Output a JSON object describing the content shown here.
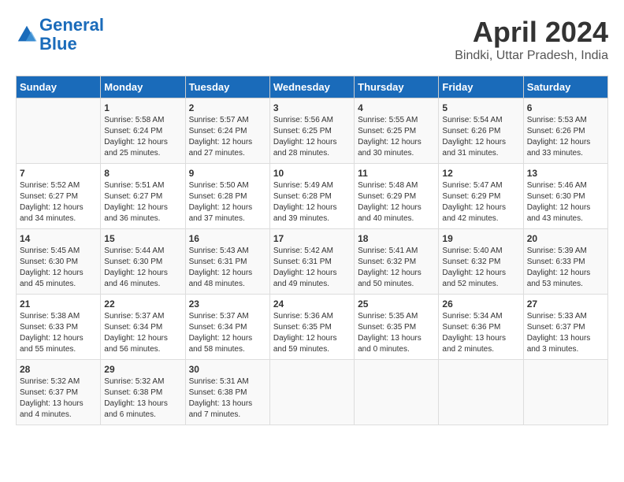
{
  "header": {
    "logo_line1": "General",
    "logo_line2": "Blue",
    "month_title": "April 2024",
    "location": "Bindki, Uttar Pradesh, India"
  },
  "weekdays": [
    "Sunday",
    "Monday",
    "Tuesday",
    "Wednesday",
    "Thursday",
    "Friday",
    "Saturday"
  ],
  "weeks": [
    [
      {
        "day": "",
        "sunrise": "",
        "sunset": "",
        "daylight": ""
      },
      {
        "day": "1",
        "sunrise": "Sunrise: 5:58 AM",
        "sunset": "Sunset: 6:24 PM",
        "daylight": "Daylight: 12 hours and 25 minutes."
      },
      {
        "day": "2",
        "sunrise": "Sunrise: 5:57 AM",
        "sunset": "Sunset: 6:24 PM",
        "daylight": "Daylight: 12 hours and 27 minutes."
      },
      {
        "day": "3",
        "sunrise": "Sunrise: 5:56 AM",
        "sunset": "Sunset: 6:25 PM",
        "daylight": "Daylight: 12 hours and 28 minutes."
      },
      {
        "day": "4",
        "sunrise": "Sunrise: 5:55 AM",
        "sunset": "Sunset: 6:25 PM",
        "daylight": "Daylight: 12 hours and 30 minutes."
      },
      {
        "day": "5",
        "sunrise": "Sunrise: 5:54 AM",
        "sunset": "Sunset: 6:26 PM",
        "daylight": "Daylight: 12 hours and 31 minutes."
      },
      {
        "day": "6",
        "sunrise": "Sunrise: 5:53 AM",
        "sunset": "Sunset: 6:26 PM",
        "daylight": "Daylight: 12 hours and 33 minutes."
      }
    ],
    [
      {
        "day": "7",
        "sunrise": "Sunrise: 5:52 AM",
        "sunset": "Sunset: 6:27 PM",
        "daylight": "Daylight: 12 hours and 34 minutes."
      },
      {
        "day": "8",
        "sunrise": "Sunrise: 5:51 AM",
        "sunset": "Sunset: 6:27 PM",
        "daylight": "Daylight: 12 hours and 36 minutes."
      },
      {
        "day": "9",
        "sunrise": "Sunrise: 5:50 AM",
        "sunset": "Sunset: 6:28 PM",
        "daylight": "Daylight: 12 hours and 37 minutes."
      },
      {
        "day": "10",
        "sunrise": "Sunrise: 5:49 AM",
        "sunset": "Sunset: 6:28 PM",
        "daylight": "Daylight: 12 hours and 39 minutes."
      },
      {
        "day": "11",
        "sunrise": "Sunrise: 5:48 AM",
        "sunset": "Sunset: 6:29 PM",
        "daylight": "Daylight: 12 hours and 40 minutes."
      },
      {
        "day": "12",
        "sunrise": "Sunrise: 5:47 AM",
        "sunset": "Sunset: 6:29 PM",
        "daylight": "Daylight: 12 hours and 42 minutes."
      },
      {
        "day": "13",
        "sunrise": "Sunrise: 5:46 AM",
        "sunset": "Sunset: 6:30 PM",
        "daylight": "Daylight: 12 hours and 43 minutes."
      }
    ],
    [
      {
        "day": "14",
        "sunrise": "Sunrise: 5:45 AM",
        "sunset": "Sunset: 6:30 PM",
        "daylight": "Daylight: 12 hours and 45 minutes."
      },
      {
        "day": "15",
        "sunrise": "Sunrise: 5:44 AM",
        "sunset": "Sunset: 6:30 PM",
        "daylight": "Daylight: 12 hours and 46 minutes."
      },
      {
        "day": "16",
        "sunrise": "Sunrise: 5:43 AM",
        "sunset": "Sunset: 6:31 PM",
        "daylight": "Daylight: 12 hours and 48 minutes."
      },
      {
        "day": "17",
        "sunrise": "Sunrise: 5:42 AM",
        "sunset": "Sunset: 6:31 PM",
        "daylight": "Daylight: 12 hours and 49 minutes."
      },
      {
        "day": "18",
        "sunrise": "Sunrise: 5:41 AM",
        "sunset": "Sunset: 6:32 PM",
        "daylight": "Daylight: 12 hours and 50 minutes."
      },
      {
        "day": "19",
        "sunrise": "Sunrise: 5:40 AM",
        "sunset": "Sunset: 6:32 PM",
        "daylight": "Daylight: 12 hours and 52 minutes."
      },
      {
        "day": "20",
        "sunrise": "Sunrise: 5:39 AM",
        "sunset": "Sunset: 6:33 PM",
        "daylight": "Daylight: 12 hours and 53 minutes."
      }
    ],
    [
      {
        "day": "21",
        "sunrise": "Sunrise: 5:38 AM",
        "sunset": "Sunset: 6:33 PM",
        "daylight": "Daylight: 12 hours and 55 minutes."
      },
      {
        "day": "22",
        "sunrise": "Sunrise: 5:37 AM",
        "sunset": "Sunset: 6:34 PM",
        "daylight": "Daylight: 12 hours and 56 minutes."
      },
      {
        "day": "23",
        "sunrise": "Sunrise: 5:37 AM",
        "sunset": "Sunset: 6:34 PM",
        "daylight": "Daylight: 12 hours and 58 minutes."
      },
      {
        "day": "24",
        "sunrise": "Sunrise: 5:36 AM",
        "sunset": "Sunset: 6:35 PM",
        "daylight": "Daylight: 12 hours and 59 minutes."
      },
      {
        "day": "25",
        "sunrise": "Sunrise: 5:35 AM",
        "sunset": "Sunset: 6:35 PM",
        "daylight": "Daylight: 13 hours and 0 minutes."
      },
      {
        "day": "26",
        "sunrise": "Sunrise: 5:34 AM",
        "sunset": "Sunset: 6:36 PM",
        "daylight": "Daylight: 13 hours and 2 minutes."
      },
      {
        "day": "27",
        "sunrise": "Sunrise: 5:33 AM",
        "sunset": "Sunset: 6:37 PM",
        "daylight": "Daylight: 13 hours and 3 minutes."
      }
    ],
    [
      {
        "day": "28",
        "sunrise": "Sunrise: 5:32 AM",
        "sunset": "Sunset: 6:37 PM",
        "daylight": "Daylight: 13 hours and 4 minutes."
      },
      {
        "day": "29",
        "sunrise": "Sunrise: 5:32 AM",
        "sunset": "Sunset: 6:38 PM",
        "daylight": "Daylight: 13 hours and 6 minutes."
      },
      {
        "day": "30",
        "sunrise": "Sunrise: 5:31 AM",
        "sunset": "Sunset: 6:38 PM",
        "daylight": "Daylight: 13 hours and 7 minutes."
      },
      {
        "day": "",
        "sunrise": "",
        "sunset": "",
        "daylight": ""
      },
      {
        "day": "",
        "sunrise": "",
        "sunset": "",
        "daylight": ""
      },
      {
        "day": "",
        "sunrise": "",
        "sunset": "",
        "daylight": ""
      },
      {
        "day": "",
        "sunrise": "",
        "sunset": "",
        "daylight": ""
      }
    ]
  ]
}
